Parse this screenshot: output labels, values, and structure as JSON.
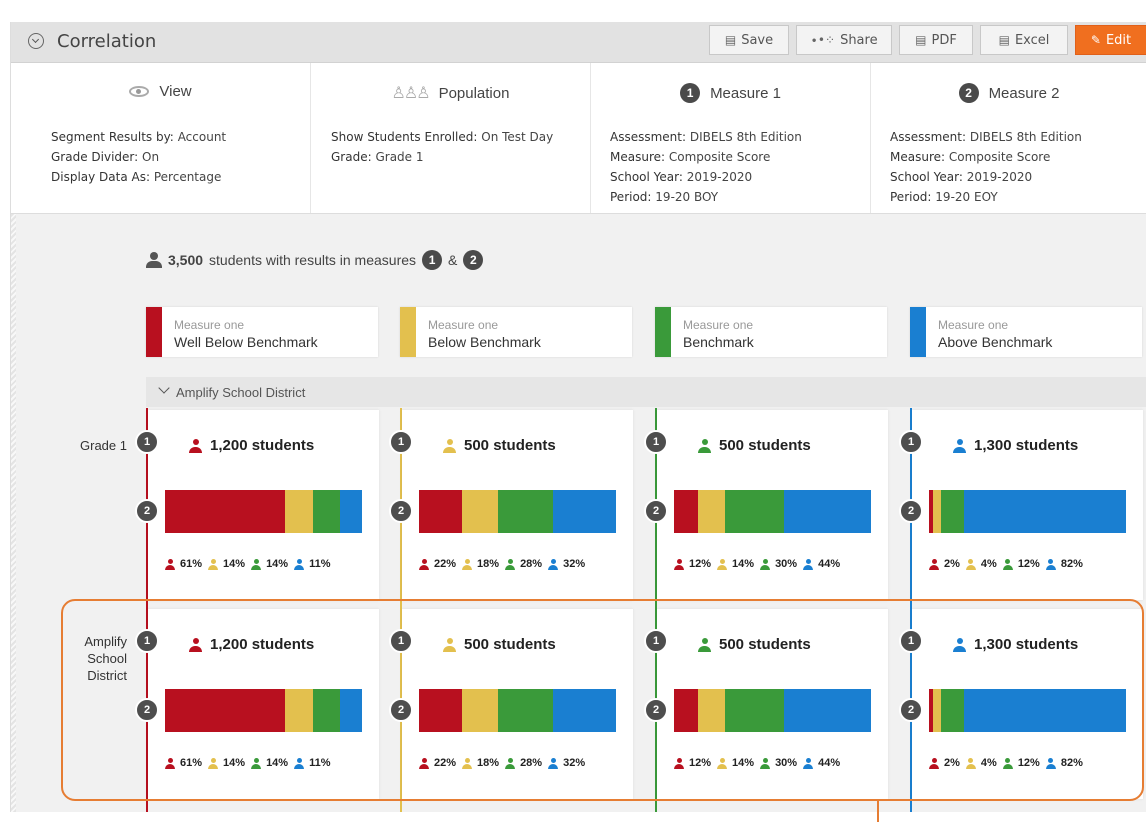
{
  "header": {
    "title": "Correlation",
    "buttons": {
      "save": "Save",
      "share": "Share",
      "pdf": "PDF",
      "excel": "Excel",
      "edit": "Edit"
    }
  },
  "info": {
    "view": {
      "title": "View",
      "lines": [
        {
          "label": "Segment Results by:",
          "value": "Account"
        },
        {
          "label": "Grade Divider:",
          "value": "On"
        },
        {
          "label": "Display Data As:",
          "value": "Percentage"
        }
      ]
    },
    "population": {
      "title": "Population",
      "lines": [
        {
          "label": "Show Students Enrolled:",
          "value": "On Test Day"
        },
        {
          "label": "Grade:",
          "value": "Grade 1"
        }
      ]
    },
    "measure1": {
      "badge": "1",
      "title": "Measure 1",
      "lines": [
        {
          "label": "Assessment:",
          "value": "DIBELS 8th Edition"
        },
        {
          "label": "Measure:",
          "value": "Composite Score"
        },
        {
          "label": "School Year:",
          "value": "2019-2020"
        },
        {
          "label": "Period:",
          "value": "19-20 BOY"
        }
      ]
    },
    "measure2": {
      "badge": "2",
      "title": "Measure 2",
      "lines": [
        {
          "label": "Assessment:",
          "value": "DIBELS 8th Edition"
        },
        {
          "label": "Measure:",
          "value": "Composite Score"
        },
        {
          "label": "School Year:",
          "value": "2019-2020"
        },
        {
          "label": "Period:",
          "value": "19-20 EOY"
        }
      ]
    }
  },
  "summary": {
    "count": "3,500",
    "text": "students with results in measures",
    "badge1": "1",
    "amp": "&",
    "badge2": "2"
  },
  "legend": [
    {
      "sub": "Measure one",
      "label": "Well Below Benchmark"
    },
    {
      "sub": "Measure one",
      "label": "Below Benchmark"
    },
    {
      "sub": "Measure one",
      "label": "Benchmark"
    },
    {
      "sub": "Measure one",
      "label": "Above Benchmark"
    }
  ],
  "colors": {
    "well_below": "#b8101f",
    "below": "#e3c04e",
    "benchmark": "#3a9a3a",
    "above": "#1a7fd1",
    "accent": "#f06f1f"
  },
  "group": {
    "label": "Amplify School District"
  },
  "rows": [
    {
      "label": "Grade 1"
    },
    {
      "label": "Amplify School District"
    }
  ],
  "row_badges": {
    "m1": "1",
    "m2": "2"
  },
  "cells": [
    {
      "students": "1,200 students",
      "segments": [
        61,
        14,
        14,
        11
      ],
      "pct_labels": [
        "61%",
        "14%",
        "14%",
        "11%"
      ]
    },
    {
      "students": "500 students",
      "segments": [
        22,
        18,
        28,
        32
      ],
      "pct_labels": [
        "22%",
        "18%",
        "28%",
        "32%"
      ]
    },
    {
      "students": "500 students",
      "segments": [
        12,
        14,
        30,
        44
      ],
      "pct_labels": [
        "12%",
        "14%",
        "30%",
        "44%"
      ]
    },
    {
      "students": "1,300 students",
      "segments": [
        2,
        4,
        12,
        82
      ],
      "pct_labels": [
        "2%",
        "4%",
        "12%",
        "82%"
      ]
    }
  ]
}
